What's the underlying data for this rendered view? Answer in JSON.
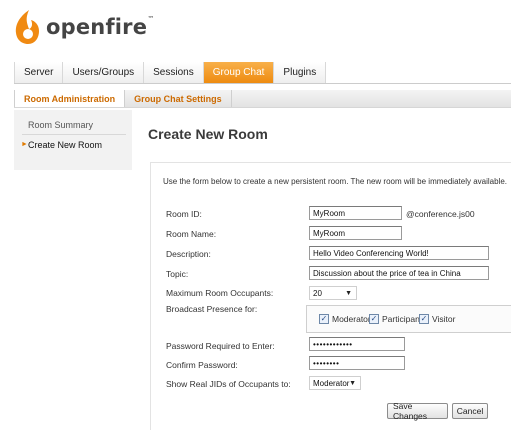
{
  "app": {
    "brand": "openfire",
    "brand_mark": "™"
  },
  "main_nav": {
    "tabs": [
      {
        "label": "Server",
        "active": false
      },
      {
        "label": "Users/Groups",
        "active": false
      },
      {
        "label": "Sessions",
        "active": false
      },
      {
        "label": "Group Chat",
        "active": true
      },
      {
        "label": "Plugins",
        "active": false
      }
    ]
  },
  "sub_nav": {
    "tabs": [
      {
        "label": "Room Administration",
        "active": true
      },
      {
        "label": "Group Chat Settings",
        "active": false
      }
    ]
  },
  "sidebar": {
    "items": [
      {
        "label": "Room Summary",
        "active": false
      },
      {
        "label": "Create New Room",
        "active": true
      }
    ]
  },
  "page": {
    "title": "Create New Room",
    "intro": "Use the form below to create a new persistent room. The new room will be immediately available."
  },
  "form": {
    "room_id": {
      "label": "Room ID:",
      "value": "MyRoom",
      "suffix": "@conference.js00"
    },
    "room_name": {
      "label": "Room Name:",
      "value": "MyRoom"
    },
    "description": {
      "label": "Description:",
      "value": "Hello Video Conferencing World!"
    },
    "topic": {
      "label": "Topic:",
      "value": "Discussion about the price of tea in China"
    },
    "max_occupants": {
      "label": "Maximum Room Occupants:",
      "value": "20"
    },
    "broadcast": {
      "label": "Broadcast Presence for:",
      "options": [
        {
          "label": "Moderator",
          "checked": true
        },
        {
          "label": "Participant",
          "checked": true
        },
        {
          "label": "Visitor",
          "checked": true
        }
      ]
    },
    "password": {
      "label": "Password Required to Enter:",
      "value": "••••••••••••"
    },
    "confirm_password": {
      "label": "Confirm Password:",
      "value": "••••••••"
    },
    "show_jids": {
      "label": "Show Real JIDs of Occupants to:",
      "value": "Moderator"
    }
  },
  "actions": {
    "save_label": "Save Changes",
    "cancel_label": "Cancel"
  },
  "colors": {
    "accent_orange": "#ee8b10",
    "link_orange": "#cc6a00"
  },
  "icons": {
    "logo": "openfire-flame-icon",
    "caret": "chevron-down-icon",
    "check": "check-icon",
    "side_arrow": "triangle-right-icon"
  }
}
